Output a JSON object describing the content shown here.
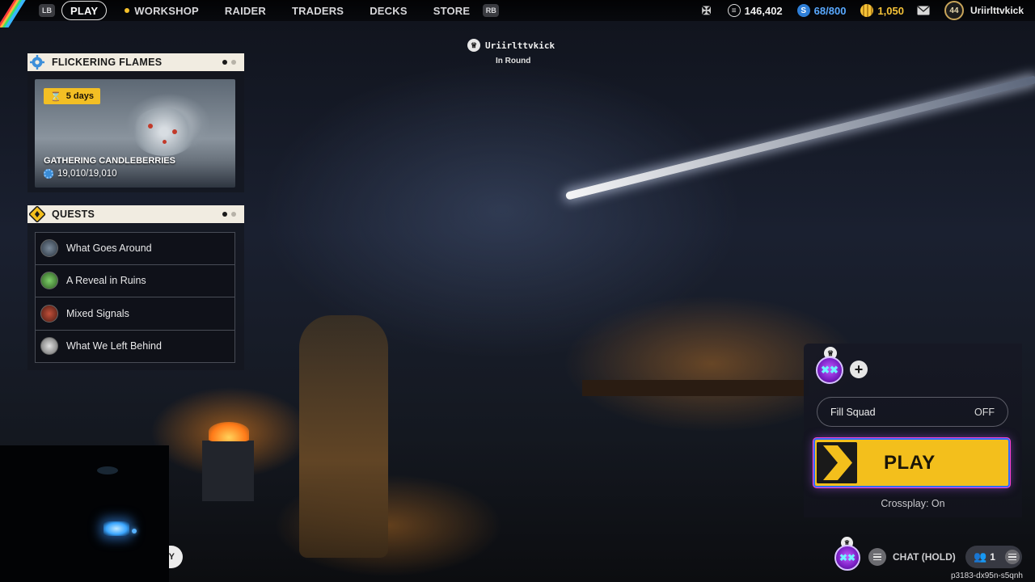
{
  "topnav": {
    "lb_hint": "LB",
    "rb_hint": "RB",
    "items": [
      {
        "label": "PLAY",
        "active": true
      },
      {
        "label": "WORKSHOP",
        "active": false
      },
      {
        "label": "RAIDER",
        "active": false
      },
      {
        "label": "TRADERS",
        "active": false
      },
      {
        "label": "DECKS",
        "active": false
      },
      {
        "label": "STORE",
        "active": false
      }
    ],
    "currencies": {
      "credits": "146,402",
      "capacity": "68/800",
      "coins": "1,050"
    },
    "player_level": "44",
    "username": "Uriirlttvkick"
  },
  "player_tag": {
    "name": "Uriirlttvkick",
    "status": "In Round"
  },
  "event_panel": {
    "title": "FLICKERING FLAMES",
    "timer": "5  days",
    "card_title": "GATHERING CANDLEBERRIES",
    "progress": "19,010/19,010"
  },
  "quests_panel": {
    "title": "QUESTS",
    "items": [
      {
        "label": "What Goes Around"
      },
      {
        "label": "A Reveal in Ruins"
      },
      {
        "label": "Mixed Signals"
      },
      {
        "label": "What We Left Behind"
      }
    ]
  },
  "squad_panel": {
    "fill_squad_label": "Fill Squad",
    "fill_squad_state": "OFF",
    "play_label": "PLAY",
    "crossplay": "Crossplay: On"
  },
  "bottom_bar": {
    "chat_label": "CHAT (HOLD)",
    "party_count": "1",
    "build_id": "p3183-dx95n-s5qnh",
    "peek_label": "Y"
  },
  "colors": {
    "accent_yellow": "#f3bf1c",
    "panel_header": "#f1ece1",
    "credits_blue": "#59a9ff",
    "coins_gold": "#f6c338"
  }
}
